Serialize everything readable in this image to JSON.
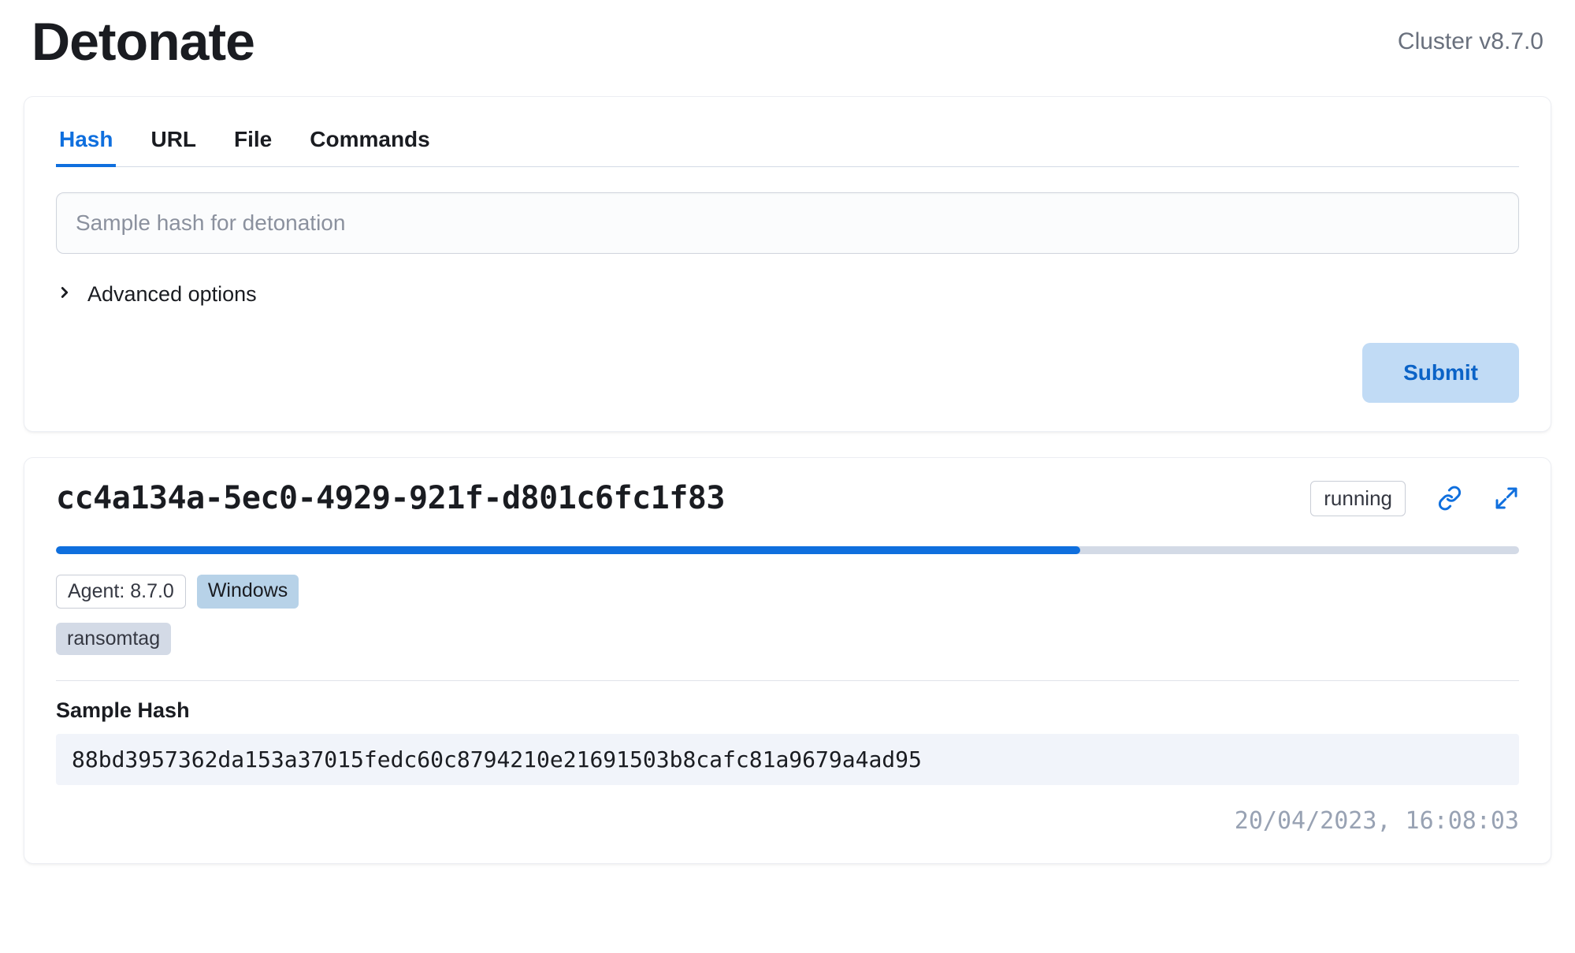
{
  "header": {
    "title": "Detonate",
    "cluster_version": "Cluster v8.7.0"
  },
  "tabs": [
    {
      "label": "Hash",
      "active": true
    },
    {
      "label": "URL",
      "active": false
    },
    {
      "label": "File",
      "active": false
    },
    {
      "label": "Commands",
      "active": false
    }
  ],
  "form": {
    "hash_placeholder": "Sample hash for detonation",
    "advanced_label": "Advanced options",
    "submit_label": "Submit"
  },
  "task": {
    "id": "cc4a134a-5ec0-4929-921f-d801c6fc1f83",
    "status": "running",
    "progress_percent": 70,
    "badges": {
      "agent": "Agent: 8.7.0",
      "os": "Windows",
      "tag": "ransomtag"
    },
    "sample_hash_label": "Sample Hash",
    "sample_hash_value": "88bd3957362da153a37015fedc60c8794210e21691503b8cafc81a9679a4ad95",
    "timestamp": "20/04/2023, 16:08:03"
  }
}
